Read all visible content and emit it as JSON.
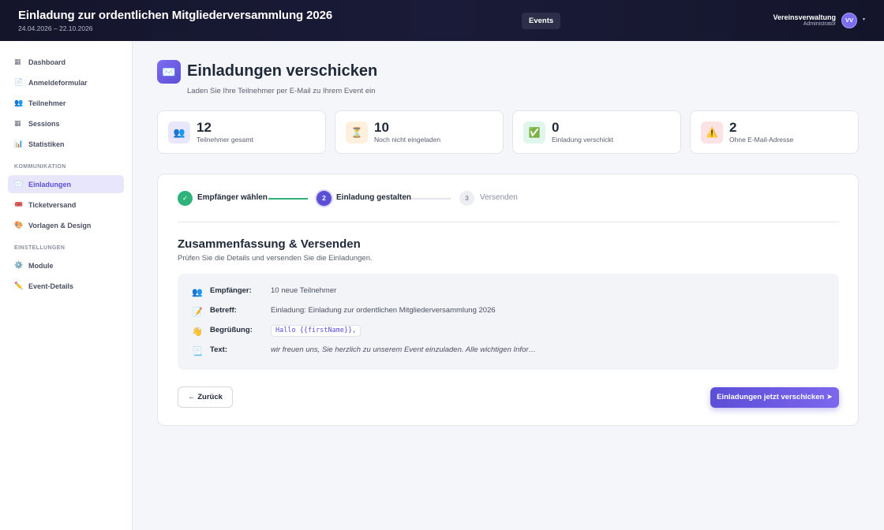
{
  "header": {
    "title": "Einladung zur ordentlichen Mitgliederversammlung 2026",
    "dates": "24.04.2026 – 22.10.2026",
    "events_label": "Events",
    "user_name": "Vereinsverwaltung",
    "user_role": "Administrator",
    "avatar_initials": "VV",
    "caret": "▾"
  },
  "sidebar": {
    "items": [
      {
        "label": "Dashboard",
        "icon": "▦"
      },
      {
        "label": "Anmeldeformular",
        "icon": "📄"
      },
      {
        "label": "Teilnehmer",
        "icon": "👥"
      },
      {
        "label": "Sessions",
        "icon": "▦"
      },
      {
        "label": "Statistiken",
        "icon": "📊"
      }
    ],
    "section_kommunikation": "KOMMUNIKATION",
    "comm_items": [
      {
        "label": "Einladungen",
        "icon": "✉️"
      },
      {
        "label": "Ticketversand",
        "icon": "🎟️"
      },
      {
        "label": "Vorlagen & Design",
        "icon": "🎨"
      }
    ],
    "section_einstellungen": "EINSTELLUNGEN",
    "settings_items": [
      {
        "label": "Module",
        "icon": "⚙️"
      },
      {
        "label": "Event-Details",
        "icon": "✏️"
      }
    ]
  },
  "page": {
    "icon": "✉️",
    "title": "Einladungen verschicken",
    "subtitle": "Laden Sie Ihre Teilnehmer per E-Mail zu Ihrem Event ein"
  },
  "stats": [
    {
      "value": "12",
      "label": "Teilnehmer gesamt",
      "icon": "👥",
      "bg": "#e9e7fb"
    },
    {
      "value": "10",
      "label": "Noch nicht eingeladen",
      "icon": "⏳",
      "bg": "#fdf0dc"
    },
    {
      "value": "0",
      "label": "Einladung verschickt",
      "icon": "✅",
      "bg": "#e1f6ea"
    },
    {
      "value": "2",
      "label": "Ohne E-Mail-Adresse",
      "icon": "⚠️",
      "bg": "#fbe3e5"
    }
  ],
  "steps": [
    {
      "number": "✓",
      "label": "Empfänger wählen",
      "state": "done"
    },
    {
      "number": "2",
      "label": "Einladung gestalten",
      "state": "active"
    },
    {
      "number": "3",
      "label": "Versenden",
      "state": "pending"
    }
  ],
  "summary": {
    "title": "Zusammenfassung & Versenden",
    "subtitle": "Prüfen Sie die Details und versenden Sie die Einladungen.",
    "rows": [
      {
        "icon": "👥",
        "key": "Empfänger:",
        "value": "10 neue Teilnehmer"
      },
      {
        "icon": "📝",
        "key": "Betreff:",
        "value": "Einladung: Einladung zur ordentlichen Mitgliederversammlung 2026"
      },
      {
        "icon": "👋",
        "key": "Begrüßung:",
        "value": "Hallo {{firstName}},"
      },
      {
        "icon": "📃",
        "key": "Text:",
        "value": "wir freuen uns, Sie herzlich zu unserem Event einzuladen. Alle wichtigen Infor…"
      }
    ]
  },
  "actions": {
    "back_label": "← Zurück",
    "send_label": "Einladungen jetzt verschicken ➤"
  },
  "colors": {
    "accent": "#5b4fd6",
    "success": "#2fb37a",
    "header_bg": "#14152b"
  }
}
